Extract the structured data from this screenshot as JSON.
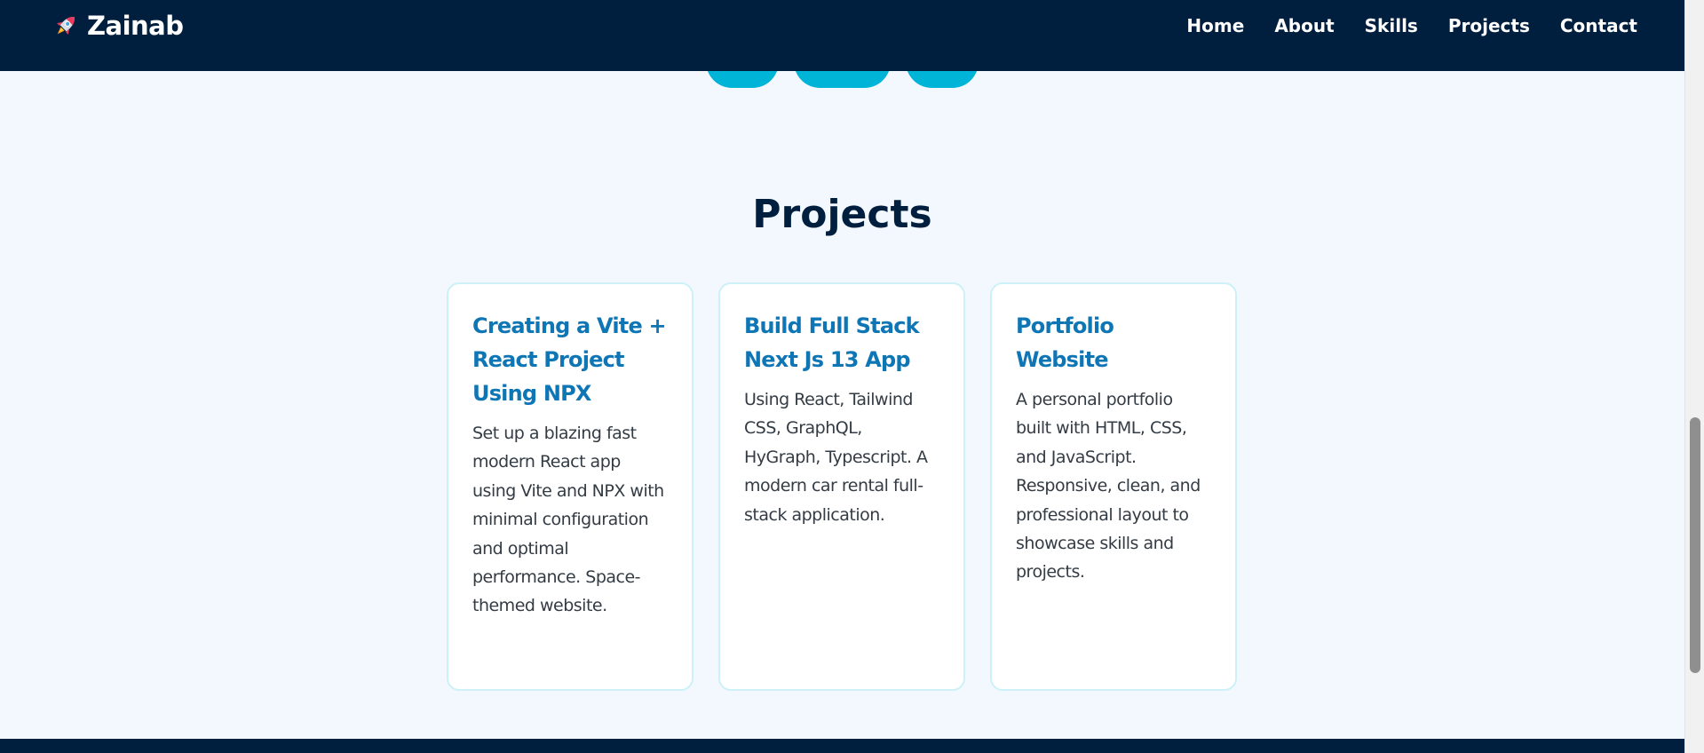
{
  "header": {
    "brand_name": "Zainab",
    "brand_icon": "rocket-icon",
    "nav": [
      {
        "label": "Home"
      },
      {
        "label": "About"
      },
      {
        "label": "Skills"
      },
      {
        "label": "Projects"
      },
      {
        "label": "Contact"
      }
    ]
  },
  "projects": {
    "title": "Projects",
    "cards": [
      {
        "title": "Creating a Vite + React Project Using NPX",
        "description": "Set up a blazing fast modern React app using Vite and NPX with minimal configuration and optimal performance. Space-themed website."
      },
      {
        "title": "Build Full Stack Next Js 13 App",
        "description": "Using React, Tailwind CSS, GraphQL, HyGraph, Typescript. A modern car rental full-stack application."
      },
      {
        "title": "Portfolio Website",
        "description": "A personal portfolio built with HTML, CSS, and JavaScript. Responsive, clean, and professional layout to showcase skills and projects."
      }
    ]
  },
  "colors": {
    "navbar_bg": "#001e3d",
    "page_bg": "#f3f7fe",
    "accent_cyan": "#00b4d8",
    "card_title": "#0f76b5",
    "card_border": "#cdf1f6",
    "heading": "#001e3d"
  }
}
